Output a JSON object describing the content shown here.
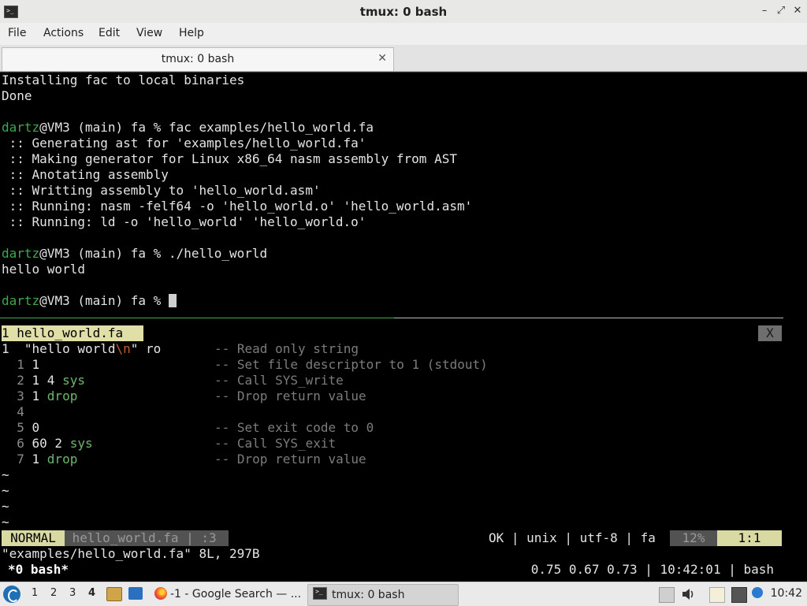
{
  "window": {
    "title": "tmux: 0 bash",
    "app_icon_glyph": ">_",
    "controls": {
      "minimize": "–",
      "maximize": "⤢",
      "close": "✕"
    }
  },
  "menu": [
    "File",
    "Actions",
    "Edit",
    "View",
    "Help"
  ],
  "tab": {
    "label": "tmux: 0 bash",
    "close_glyph": "✕"
  },
  "shell": {
    "line1": "Installing fac to local binaries",
    "line2": "Done",
    "prompt_user": "dartz",
    "prompt_rest": "@VM3 (main) fa % ",
    "cmd1": "fac examples/hello_world.fa",
    "out": [
      " :: Generating ast for 'examples/hello_world.fa'",
      " :: Making generator for Linux x86_64 nasm assembly from AST",
      " :: Anotating assembly",
      " :: Writting assembly to 'hello_world.asm'",
      " :: Running: nasm -felf64 -o 'hello_world.o' 'hello_world.asm'",
      " :: Running: ld -o 'hello_world' 'hello_world.o'"
    ],
    "cmd2": "./hello_world",
    "program_output": "hello world"
  },
  "vim": {
    "tab_label": " 1 hello_world.fa ",
    "close_label": "X",
    "line1": {
      "num": "1",
      "pre": "  \"hello world",
      "esc": "\\n",
      "post": "\" ro  ",
      "comment": "-- Read only string"
    },
    "lines": [
      {
        "num": "  1 ",
        "a": "1",
        "b": "",
        "comment": "-- Set file descriptor to 1 (stdout)"
      },
      {
        "num": "  2 ",
        "a": "1 4 ",
        "b": "sys",
        "comment": "-- Call SYS_write"
      },
      {
        "num": "  3 ",
        "a": "1 ",
        "b": "drop",
        "comment": "-- Drop return value"
      },
      {
        "num": "  4 ",
        "a": "",
        "b": "",
        "comment": ""
      },
      {
        "num": "  5 ",
        "a": "0",
        "b": "",
        "comment": "-- Set exit code to 0"
      },
      {
        "num": "  6 ",
        "a": "60 2 ",
        "b": "sys",
        "comment": "-- Call SYS_exit"
      },
      {
        "num": "  7 ",
        "a": "1 ",
        "b": "drop",
        "comment": "-- Drop return value"
      }
    ],
    "tilde": "~",
    "status": {
      "mode": "NORMAL",
      "file": " hello_world.fa | :3",
      "right": "OK | unix | utf-8 | fa ",
      "percent": "12%",
      "position": "1:1"
    },
    "message": "\"examples/hello_world.fa\" 8L, 297B"
  },
  "tmux": {
    "window": "*0 bash*",
    "right": "0.75 0.67 0.73 | 10:42:01 | bash"
  },
  "taskbar": {
    "workspaces": [
      "1",
      "2",
      "3",
      "4"
    ],
    "task_browser": "-1 - Google Search — ...",
    "task_terminal": "tmux: 0 bash",
    "clock": "10:42"
  }
}
